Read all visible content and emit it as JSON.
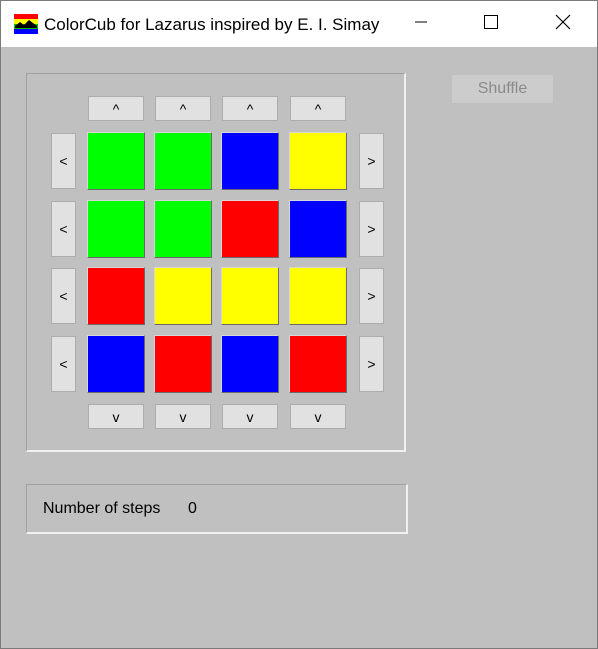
{
  "window": {
    "title": "ColorCub for Lazarus inspired by E. I. Simay",
    "minimize_icon": "minimize-icon",
    "maximize_icon": "maximize-icon",
    "close_icon": "close-icon"
  },
  "controls": {
    "up_label": "^",
    "down_label": "v",
    "left_label": "<",
    "right_label": ">",
    "shuffle_label": "Shuffle",
    "shuffle_enabled": false
  },
  "grid": {
    "rows": [
      [
        "green",
        "green",
        "blue",
        "yellow"
      ],
      [
        "green",
        "green",
        "red",
        "blue"
      ],
      [
        "red",
        "yellow",
        "yellow",
        "yellow"
      ],
      [
        "blue",
        "red",
        "blue",
        "red"
      ]
    ]
  },
  "colors": {
    "green": "#00ff00",
    "blue": "#0000ff",
    "red": "#ff0000",
    "yellow": "#ffff00"
  },
  "status": {
    "steps_label": "Number of steps",
    "steps_value": "0"
  }
}
